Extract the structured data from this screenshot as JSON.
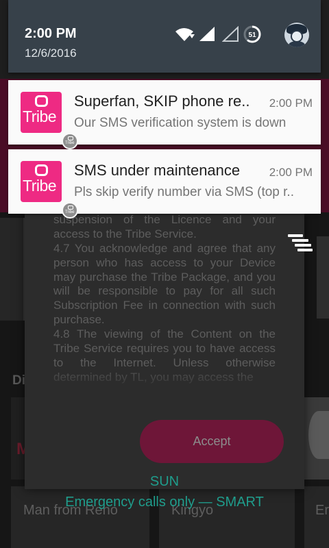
{
  "status_bar": {
    "time": "2:00 PM",
    "date": "12/6/2016",
    "battery_level": "51",
    "icons": [
      "wifi-icon",
      "signal-icon",
      "signal-empty-icon",
      "battery-icon",
      "user-avatar-icon"
    ]
  },
  "notifications": [
    {
      "app_icon_text": "Tribe",
      "title": "Superfan, SKIP phone re..",
      "time": "2:00 PM",
      "text": "Our SMS verification system is down"
    },
    {
      "app_icon_text": "Tribe",
      "title": "SMS under maintenance",
      "time": "2:00 PM",
      "text": "Pls skip verify number via SMS (top r.."
    }
  ],
  "small_icon_text": "Tribe",
  "dialog": {
    "terms": [
      "sanctions and is grounds for immediate suspension of the Licence and your access to the Tribe Service.",
      "4.7 You acknowledge and agree that any person who has access to your Device may purchase the Tribe Package, and you will be responsible to pay for all such Subscription Fee in connection with such purchase.",
      "4.8 The viewing of the Content on the Tribe Service requires you to have access to the Internet. Unless otherwise determined by TL, you may access the"
    ],
    "accept_label": "Accept"
  },
  "background": {
    "section_title": "Di",
    "thumb_letter": "M",
    "cards": [
      "Man from Reno",
      "Kingyo",
      "Er"
    ]
  },
  "carrier": {
    "day": "SUN",
    "emergency": "Emergency calls only — SMART"
  },
  "colors": {
    "tribe_pink": "#ee2a83",
    "accept_button": "#6e1638",
    "carrier_text": "#1f9d8c",
    "shade_header": "#37414a"
  }
}
